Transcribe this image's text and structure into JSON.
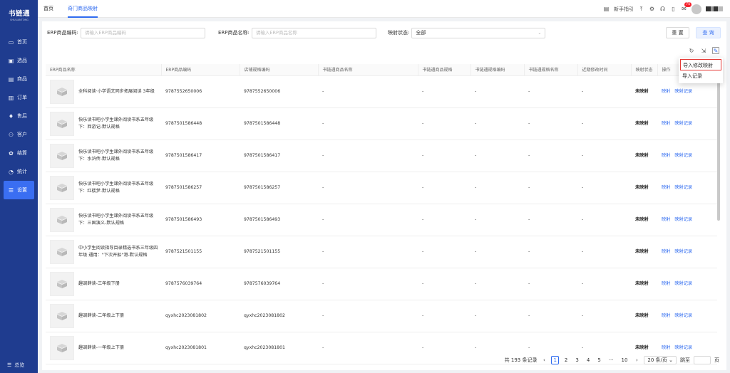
{
  "sidebar": {
    "logo_title": "书链通",
    "logo_sub": "SHULIANTONG",
    "items": [
      {
        "label": "首页",
        "icon": "monitor-icon"
      },
      {
        "label": "选品",
        "icon": "box-icon"
      },
      {
        "label": "商品",
        "icon": "goods-icon"
      },
      {
        "label": "订单",
        "icon": "order-icon"
      },
      {
        "label": "售后",
        "icon": "aftersale-icon"
      },
      {
        "label": "客户",
        "icon": "customer-icon"
      },
      {
        "label": "结算",
        "icon": "settlement-icon"
      },
      {
        "label": "统计",
        "icon": "stats-icon"
      },
      {
        "label": "设置",
        "icon": "settings-icon"
      }
    ],
    "active_index": 8,
    "collapse_label": "总览"
  },
  "topbar": {
    "tabs": [
      "首页",
      "奇门商品映射"
    ],
    "guide_label": "新手指引",
    "badge_count": "75"
  },
  "filters": {
    "erp_code_label": "ERP商品编码:",
    "erp_code_placeholder": "请输入ERP商品编码",
    "erp_name_label": "ERP商品名称:",
    "erp_name_placeholder": "请输入ERP商品名称",
    "map_status_label": "映射状态:",
    "map_status_value": "全部",
    "reset_label": "重 置",
    "query_label": "查 询"
  },
  "dropdown": {
    "items": [
      "导入修改映射",
      "导入记录"
    ]
  },
  "table": {
    "headers": [
      "ERP商品名称",
      "ERP商品编码",
      "店铺规格编码",
      "书链通商品名称",
      "书链通商品规格",
      "书链通规格编码",
      "书链通规格名称",
      "近期修改时间",
      "映射状态",
      "操作"
    ],
    "rows": [
      {
        "name": "全科阅读·小学语文同步拓展阅读 3年级",
        "erp_code": "9787552650006",
        "shop_code": "9787552650006",
        "sl_name": "-",
        "sl_spec": "-",
        "sl_code": "-",
        "sl_spec_name": "-",
        "modified": "-",
        "status": "未映射",
        "op1": "映射",
        "op2": "映射记录"
      },
      {
        "name": "快乐读书吧小学生课外阅读书系五年级下：西游记-默认规格",
        "erp_code": "9787501586448",
        "shop_code": "9787501586448",
        "sl_name": "-",
        "sl_spec": "-",
        "sl_code": "-",
        "sl_spec_name": "-",
        "modified": "-",
        "status": "未映射",
        "op1": "映射",
        "op2": "映射记录"
      },
      {
        "name": "快乐读书吧小学生课外阅读书系五年级下：水浒传-默认规格",
        "erp_code": "9787501586417",
        "shop_code": "9787501586417",
        "sl_name": "-",
        "sl_spec": "-",
        "sl_code": "-",
        "sl_spec_name": "-",
        "modified": "-",
        "status": "未映射",
        "op1": "映射",
        "op2": "映射记录"
      },
      {
        "name": "快乐读书吧小学生课外阅读书系五年级下：红楼梦-默认规格",
        "erp_code": "9787501586257",
        "shop_code": "9787501586257",
        "sl_name": "-",
        "sl_spec": "-",
        "sl_code": "-",
        "sl_spec_name": "-",
        "modified": "-",
        "status": "未映射",
        "op1": "映射",
        "op2": "映射记录"
      },
      {
        "name": "快乐读书吧小学生课外阅读书系五年级下：三国演义-默认规格",
        "erp_code": "9787501586493",
        "shop_code": "9787501586493",
        "sl_name": "-",
        "sl_spec": "-",
        "sl_code": "-",
        "sl_spec_name": "-",
        "modified": "-",
        "status": "未映射",
        "op1": "映射",
        "op2": "映射记录"
      },
      {
        "name": "中小学生阅读指导目录精选书系三年级四年级 通用：\"下次开船\"港-默认规格",
        "erp_code": "9787521501155",
        "shop_code": "9787521501155",
        "sl_name": "-",
        "sl_spec": "-",
        "sl_code": "-",
        "sl_spec_name": "-",
        "modified": "-",
        "status": "未映射",
        "op1": "映射",
        "op2": "映射记录"
      },
      {
        "name": "趣调薛读-三年级下册",
        "erp_code": "9787576039764",
        "shop_code": "9787576039764",
        "sl_name": "-",
        "sl_spec": "-",
        "sl_code": "-",
        "sl_spec_name": "-",
        "modified": "-",
        "status": "未映射",
        "op1": "映射",
        "op2": "映射记录"
      },
      {
        "name": "趣调薛读-二年级上下册",
        "erp_code": "qyxhc2023081802",
        "shop_code": "qyxhc2023081802",
        "sl_name": "-",
        "sl_spec": "-",
        "sl_code": "-",
        "sl_spec_name": "-",
        "modified": "-",
        "status": "未映射",
        "op1": "映射",
        "op2": "映射记录"
      },
      {
        "name": "趣调薛读-一年级上下册",
        "erp_code": "qyxhc2023081801",
        "shop_code": "qyxhc2023081801",
        "sl_name": "-",
        "sl_spec": "-",
        "sl_code": "-",
        "sl_spec_name": "-",
        "modified": "-",
        "status": "未映射",
        "op1": "映射",
        "op2": "映射记录"
      }
    ]
  },
  "pagination": {
    "total_label": "共 193 条记录",
    "pages": [
      "1",
      "2",
      "3",
      "4",
      "5"
    ],
    "ellipsis": "···",
    "last_page": "10",
    "current": "1",
    "page_size": "20 条/页",
    "jump_label": "跳至",
    "page_unit": "页"
  },
  "colors": {
    "sidebar_bg": "#1f3c8f",
    "accent": "#2f6bf0",
    "highlight_border": "#e53935"
  }
}
